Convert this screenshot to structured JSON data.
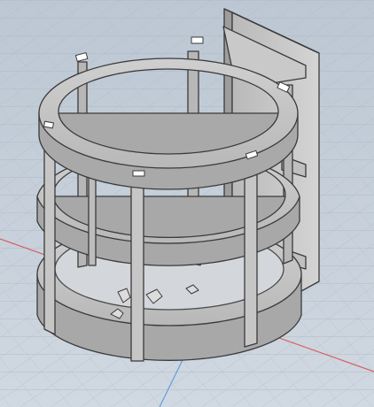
{
  "viewport": {
    "kind": "cad-3d-viewport",
    "visual_style": "shaded-with-edges",
    "background_color": "#c8d2dd",
    "grid_color": "#a8b6c4",
    "model_face_color": "#c4c4c4",
    "model_shadow_color": "#9c9c9c",
    "model_edge_color": "#3a3a3a",
    "axis_colors": {
      "x_axis": "#d84848",
      "y_axis": "#4c8fd8"
    },
    "model": {
      "name": "",
      "parts": [
        "top-ring",
        "middle-ring",
        "bottom-ring",
        "vertical-posts",
        "wall-mount-plate",
        "mount-brackets",
        "leaf-ornaments"
      ]
    }
  }
}
